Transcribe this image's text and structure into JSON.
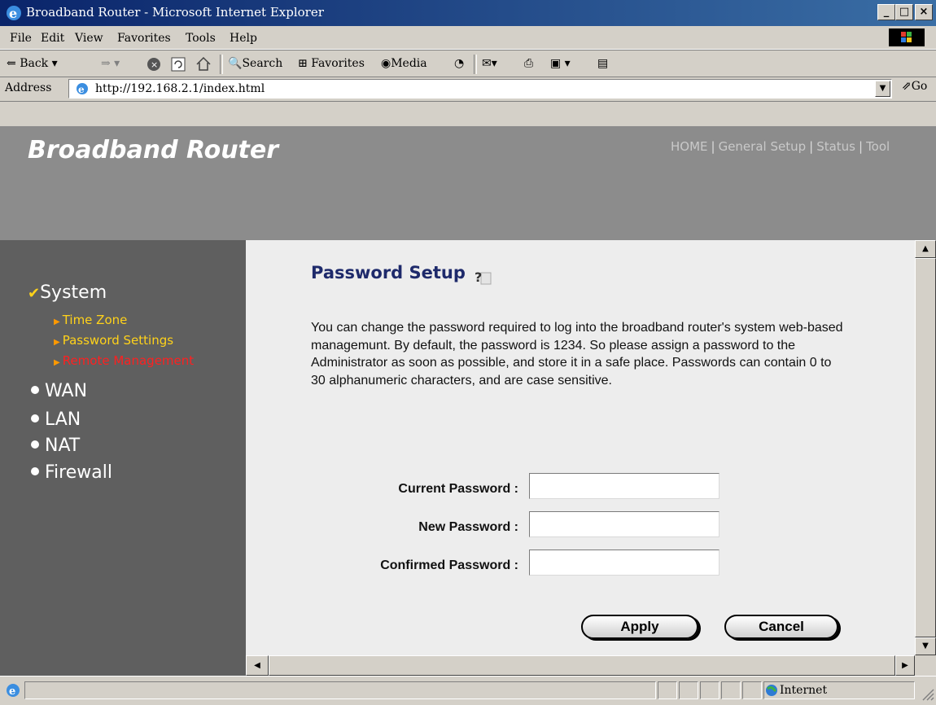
{
  "window": {
    "title": "Broadband Router - Microsoft Internet Explorer"
  },
  "menu": [
    "File",
    "Edit",
    "View",
    "Favorites",
    "Tools",
    "Help"
  ],
  "toolbar": {
    "back": "Back",
    "search": "Search",
    "favorites": "Favorites",
    "media": "Media"
  },
  "address": {
    "label": "Address",
    "url": "http://192.168.2.1/index.html",
    "go": "Go"
  },
  "banner": {
    "title": "Broadband Router",
    "nav": [
      "HOME",
      "General Setup",
      "Status",
      "Tool"
    ]
  },
  "sidebar": {
    "system": "System",
    "system_items": [
      "Time Zone",
      "Password Settings",
      "Remote Management"
    ],
    "sections": [
      "WAN",
      "LAN",
      "NAT",
      "Firewall"
    ]
  },
  "content": {
    "title": "Password Setup",
    "description": "You can change the password required to log into the broadband router's system web-based managemunt. By default, the password is 1234. So please assign a password to the Administrator as soon as possible, and store it in a safe place. Passwords can contain 0 to 30 alphanumeric characters, and are case sensitive.",
    "fields": [
      {
        "label": "Current Password :",
        "value": ""
      },
      {
        "label": "New Password :",
        "value": ""
      },
      {
        "label": "Confirmed Password :",
        "value": ""
      }
    ],
    "apply": "Apply",
    "cancel": "Cancel"
  },
  "status": {
    "zone": "Internet"
  },
  "colors": {
    "titlebar": "#0a246a",
    "banner": "#8c8c8c",
    "sidebar": "#5f5f5f",
    "page_title": "#1e2a6b",
    "sub_link": "#ffd21a",
    "active_link": "#ff2020"
  },
  "icons": [
    "ie-logo-icon",
    "windows-flag-icon",
    "back-arrow-icon",
    "forward-arrow-icon",
    "stop-icon",
    "refresh-icon",
    "home-icon",
    "search-icon",
    "favorites-icon",
    "media-icon",
    "history-icon",
    "mail-icon",
    "print-icon",
    "edit-icon",
    "discuss-icon",
    "page-icon",
    "go-arrow-icon",
    "help-icon",
    "checkmark-icon",
    "globe-icon"
  ]
}
